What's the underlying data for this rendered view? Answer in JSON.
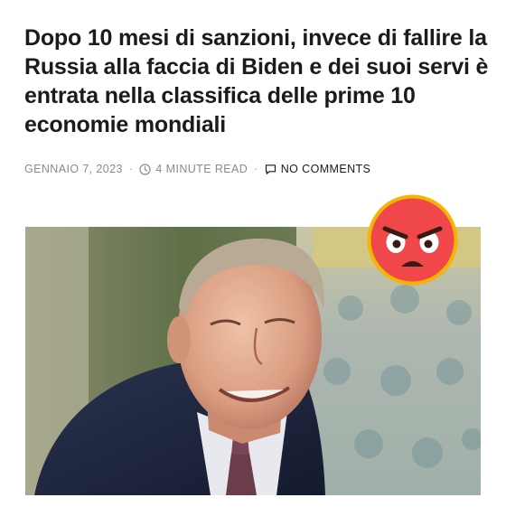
{
  "article": {
    "title": "Dopo 10 mesi di sanzioni, invece di fallire la Russia alla faccia di Biden e dei suoi servi è entrata nella classifica delle prime 10 economie mondiali",
    "date": "GENNAIO 7, 2023",
    "read_time": "4 MINUTE READ",
    "comments": "NO COMMENTS",
    "separator": "·"
  },
  "icons": {
    "clock": "clock-icon",
    "comment": "comment-bubble-icon",
    "reaction": "angry-face-emoji"
  },
  "colors": {
    "title": "#1b1b1b",
    "meta": "#8a8a8a",
    "emoji_face": "#f0484a",
    "emoji_outline": "#f5b400"
  }
}
